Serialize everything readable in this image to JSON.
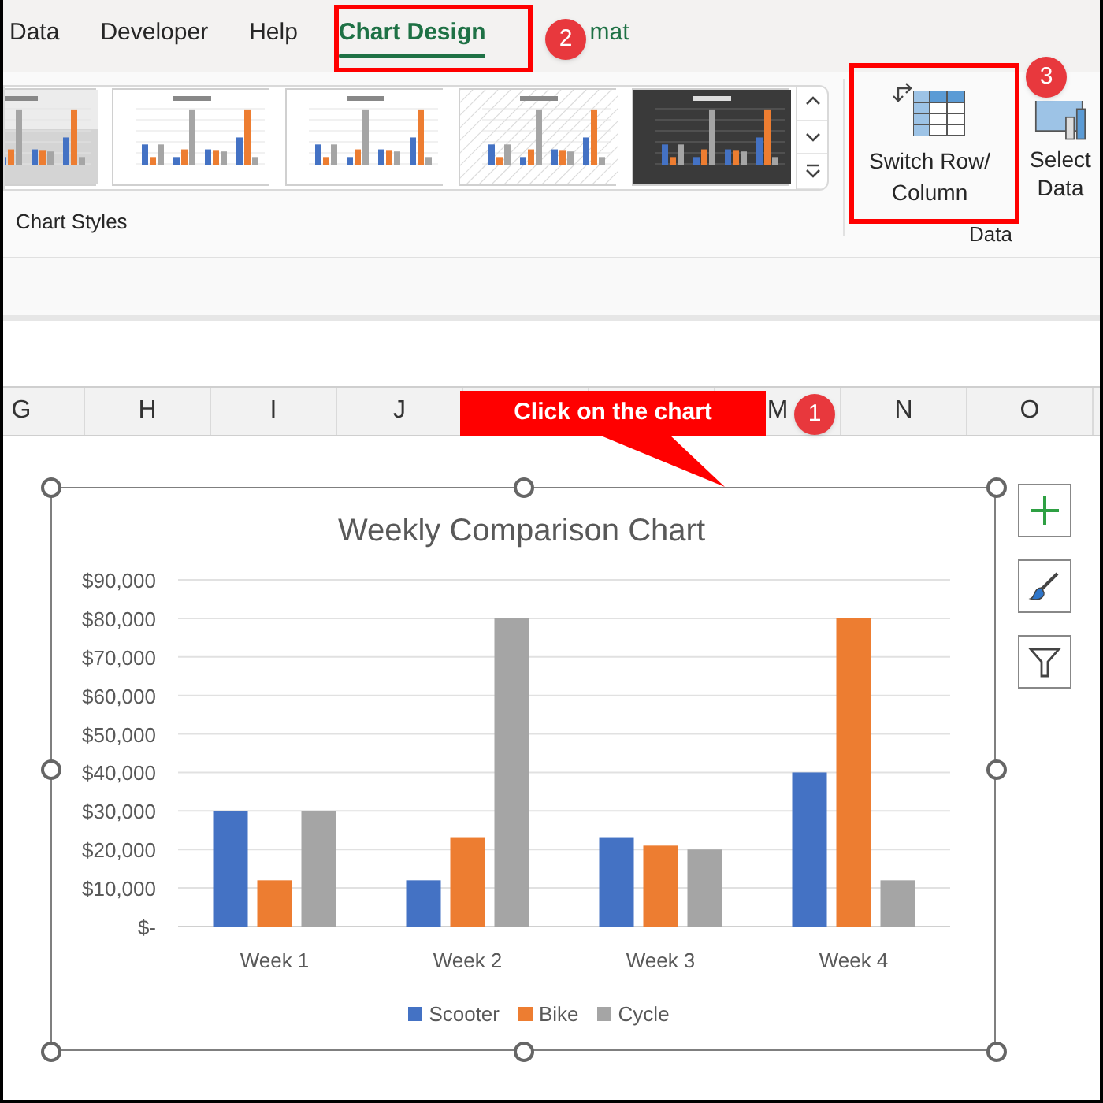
{
  "ribbon_tabs": [
    {
      "label": "Data",
      "selected": false
    },
    {
      "label": "Developer",
      "selected": false
    },
    {
      "label": "Help",
      "selected": false
    },
    {
      "label": "Chart Design",
      "selected": true
    },
    {
      "label": "mat",
      "selected": false
    }
  ],
  "chart_styles": {
    "label": "Chart Styles",
    "thumbnails": [
      {
        "kind": "gradient"
      },
      {
        "kind": "light"
      },
      {
        "kind": "light"
      },
      {
        "kind": "pattern"
      },
      {
        "kind": "dark"
      }
    ]
  },
  "data_group": {
    "label": "Data",
    "buttons": [
      {
        "kind": "switch",
        "label": "Switch Row/ Column"
      },
      {
        "kind": "select",
        "label": "Select Data"
      }
    ]
  },
  "columns": [
    "G",
    "H",
    "I",
    "J",
    "M",
    "N",
    "O"
  ],
  "callout": {
    "text": "Click on the chart"
  },
  "badges": [
    "1",
    "2",
    "3"
  ],
  "chart": {
    "chart_data": {
      "type": "bar",
      "title": "Weekly Comparison Chart",
      "categories": [
        "Week 1",
        "Week 2",
        "Week 3",
        "Week 4"
      ],
      "series": [
        {
          "name": "Scooter",
          "color": "#4472c4",
          "values": [
            30000,
            12000,
            23000,
            40000
          ]
        },
        {
          "name": "Bike",
          "color": "#ed7d31",
          "values": [
            12000,
            23000,
            21000,
            80000
          ]
        },
        {
          "name": "Cycle",
          "color": "#a5a5a5",
          "values": [
            30000,
            80000,
            20000,
            12000
          ]
        }
      ],
      "ylim": [
        0,
        90000
      ],
      "grid": true,
      "legend": "bottom",
      "yticks": [
        {
          "value": 0,
          "label": "$-"
        },
        {
          "value": 10000,
          "label": "$10,000"
        },
        {
          "value": 20000,
          "label": "$20,000"
        },
        {
          "value": 30000,
          "label": "$30,000"
        },
        {
          "value": 40000,
          "label": "$40,000"
        },
        {
          "value": 50000,
          "label": "$50,000"
        },
        {
          "value": 60000,
          "label": "$60,000"
        },
        {
          "value": 70000,
          "label": "$70,000"
        },
        {
          "value": 80000,
          "label": "$80,000"
        },
        {
          "value": 90000,
          "label": "$90,000"
        }
      ]
    }
  }
}
